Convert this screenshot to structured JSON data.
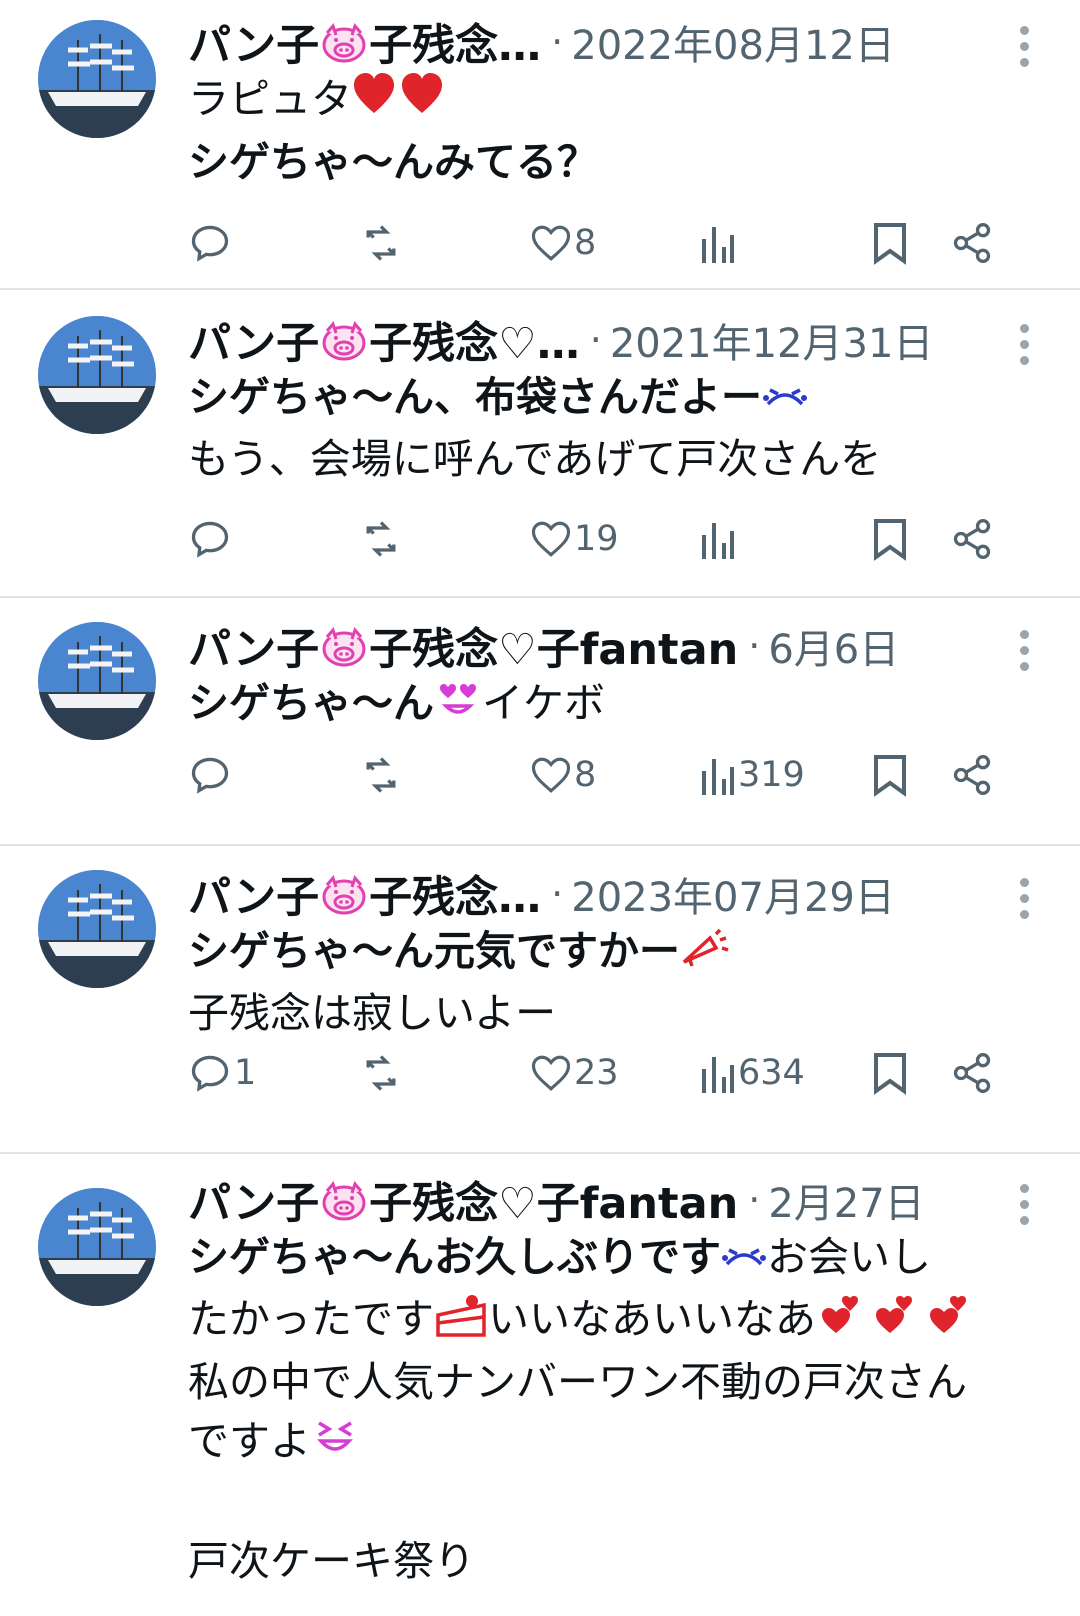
{
  "posts": [
    {
      "author": "パン子🐷子残念…",
      "date": "2022年08月12日",
      "lines": [
        "ラピュタ❤️❤️",
        "シゲちゃ〜んみてる？"
      ],
      "replies": "",
      "likes": "8",
      "views": ""
    },
    {
      "author": "パン子🐷子残念♡…",
      "date": "2021年12月31日",
      "lines": [
        "シゲちゃ〜ん、布袋さんだよー😭",
        "もう、会場に呼んであげて戸次さんを"
      ],
      "replies": "",
      "likes": "19",
      "views": ""
    },
    {
      "author": "パン子🐷子残念♡子fantan",
      "date": "6月6日",
      "lines": [
        "シゲちゃ〜ん😍イケボ"
      ],
      "replies": "",
      "likes": "8",
      "views": "319"
    },
    {
      "author": "パン子🐷子残念…",
      "date": "2023年07月29日",
      "lines": [
        "シゲちゃ〜ん元気ですかー📣",
        "子残念は寂しいよー"
      ],
      "replies": "1",
      "likes": "23",
      "views": "634"
    },
    {
      "author": "パン子🐷子残念♡子fantan",
      "date": "2月27日",
      "lines": [
        "シゲちゃ〜んお久しぶりです😭お会いし",
        "たかったです🍰いいなあいいなあ💕💕💕",
        "私の中で人気ナンバーワン不動の戸次さん",
        "ですよ😆",
        "",
        "戸次ケーキ祭り"
      ],
      "replies": "",
      "likes": "",
      "views": ""
    }
  ],
  "icons": {
    "reply": "reply-icon",
    "repost": "repost-icon",
    "like": "heart-icon",
    "views": "views-icon",
    "bookmark": "bookmark-icon",
    "share": "share-icon",
    "more": "more-icon"
  },
  "colors": {
    "text": "#0f1419",
    "muted": "#536471",
    "border": "#dfe3e6",
    "pig": "#e040b0",
    "heart": "#e0242b"
  }
}
